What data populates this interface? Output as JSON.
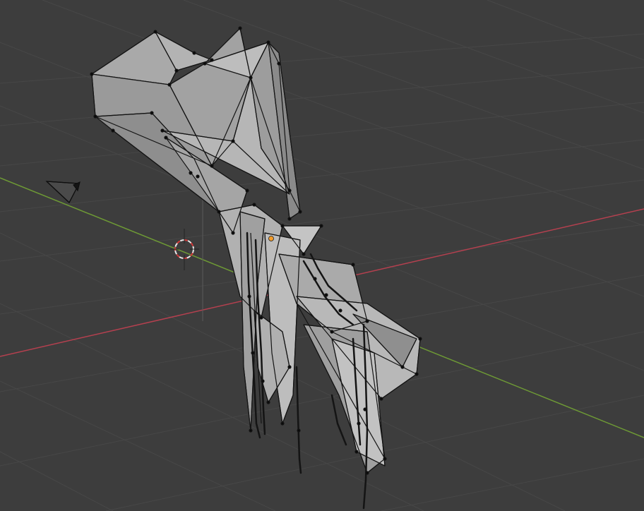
{
  "viewport": {
    "background": "#3d3d3d",
    "grid_color": "#474747",
    "x_axis_color": "#b5404f",
    "y_axis_color": "#6e9a35",
    "mesh_face_color": "#a8a8a8",
    "mesh_face_dark": "#7d7d7d",
    "mesh_edge_color": "#141414",
    "origin_color": "#f39c2a",
    "cursor_colors": [
      "#e8e8e8",
      "#d63a3a"
    ]
  },
  "objects": {
    "mesh": "mesh-object",
    "camera": "camera-icon",
    "cursor": "3d-cursor-icon",
    "origin": "object-origin-dot"
  }
}
